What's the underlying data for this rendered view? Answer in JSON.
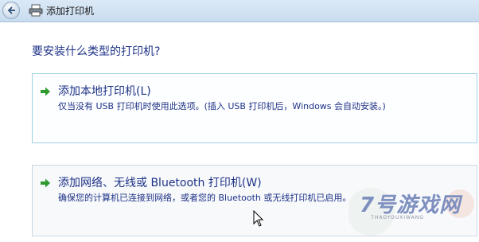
{
  "window": {
    "title": "添加打印机"
  },
  "main": {
    "question": "要安装什么类型的打印机?",
    "options": [
      {
        "title": "添加本地打印机(L)",
        "description": "仅当没有 USB 打印机时使用此选项。(插入 USB 打印机后，Windows 会自动安装。)"
      },
      {
        "title": "添加网络、无线或 Bluetooth 打印机(W)",
        "description": "确保您的计算机已连接到网络，或者您的 Bluetooth 或无线打印机已启用。"
      }
    ]
  },
  "watermark": {
    "text": "7号游戏网",
    "subtext": "7HAOYOUXIWANG"
  },
  "colors": {
    "link_blue": "#1e3287",
    "arrow_green": "#2d9a2d",
    "option_border": "#9fd2e4"
  },
  "icons": {
    "back": "back-arrow-icon",
    "printer": "printer-icon",
    "option_arrow": "green-arrow-icon"
  }
}
